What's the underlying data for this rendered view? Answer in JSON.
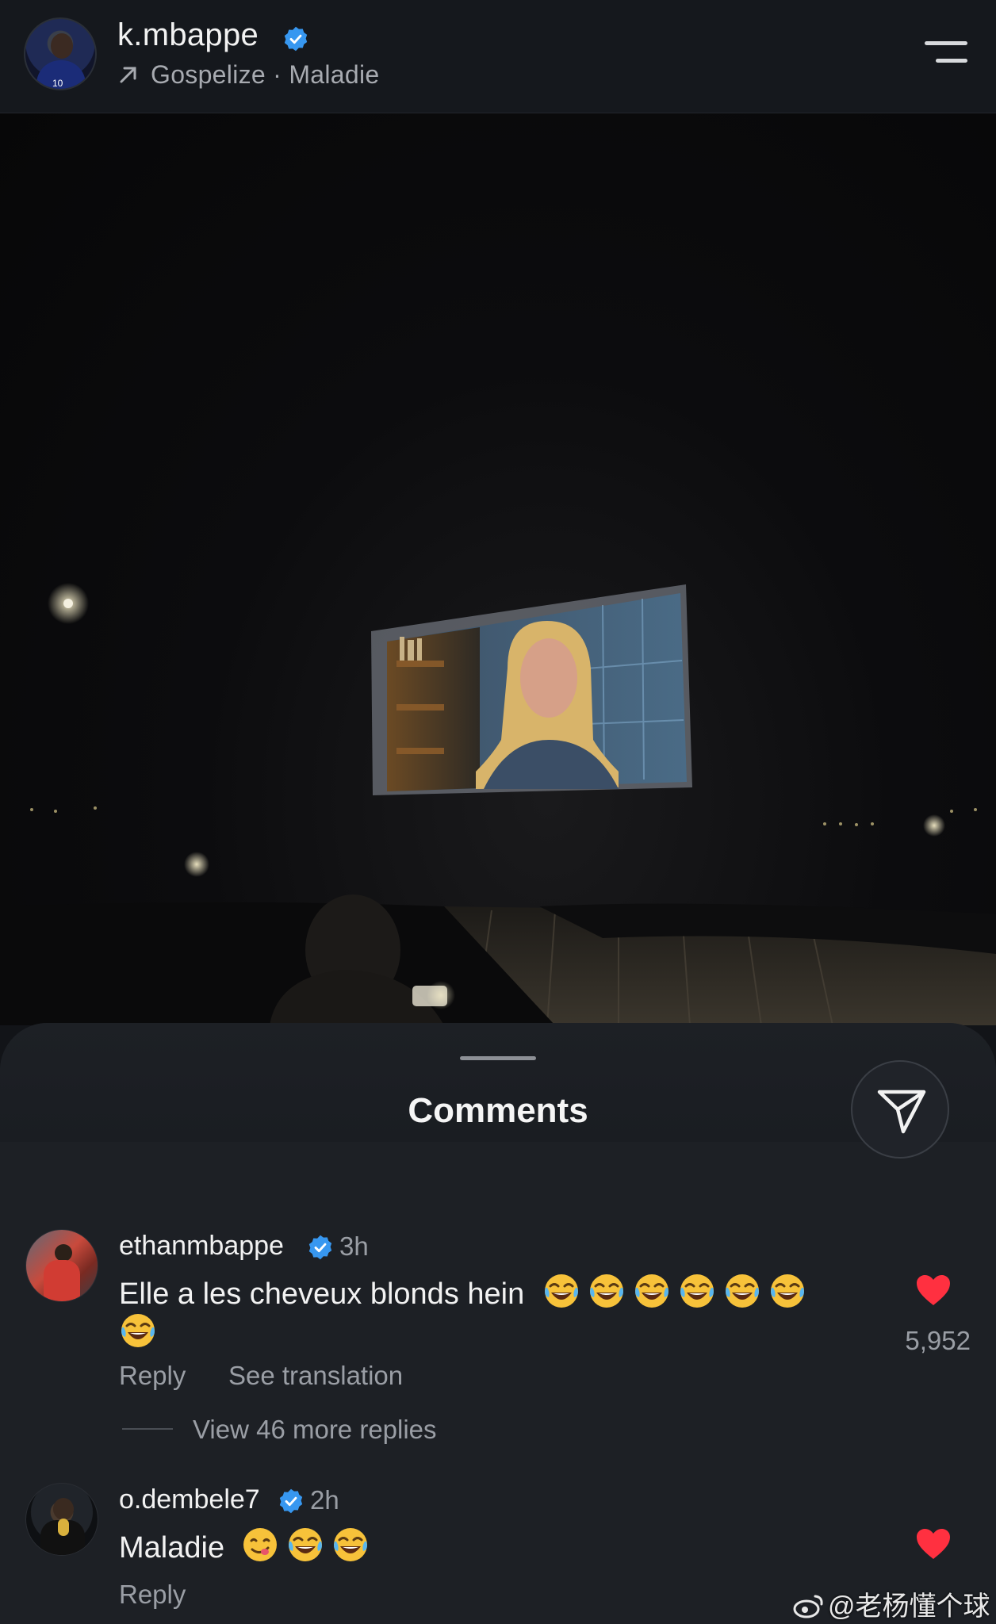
{
  "header": {
    "username": "k.mbappe",
    "subline": "Gospelize · Maladie"
  },
  "sheet": {
    "title": "Comments"
  },
  "comments": [
    {
      "user": "ethanmbappe",
      "time": "3h",
      "text": "Elle a les cheveux blonds hein",
      "likes": "5,952",
      "reply_label": "Reply",
      "translation_label": "See translation",
      "more_replies": "View 46 more replies"
    },
    {
      "user": "o.dembele7",
      "time": "2h",
      "text": "Maladie",
      "reply_label": "Reply"
    }
  ],
  "watermark": "@老杨懂个球",
  "colors": {
    "verified": "#3797f0",
    "heart": "#ff3040",
    "background": "#121418"
  },
  "icons": [
    "verified-badge-icon",
    "menu-icon",
    "share-icon",
    "heart-icon",
    "laughing-emoji-icon",
    "yum-emoji-icon",
    "weibo-icon",
    "arrow-up-right-icon"
  ]
}
